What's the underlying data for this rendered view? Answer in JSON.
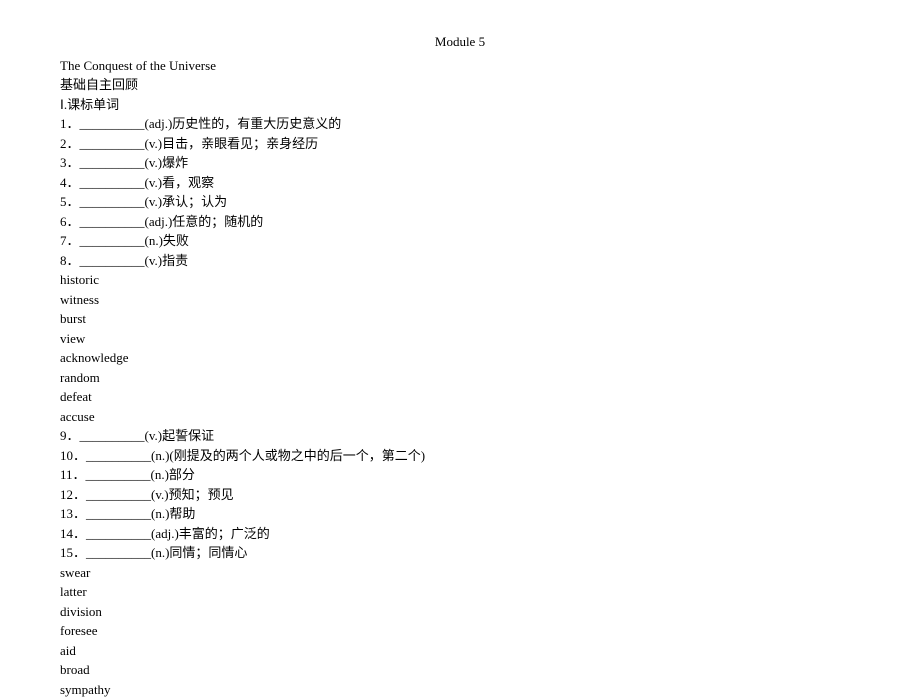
{
  "module_title": "Module 5",
  "title": "The Conquest of the Universe",
  "section": "基础自主回顾",
  "subsection": "Ⅰ.课标单词",
  "items1": [
    "1．__________(adj.)历史性的，有重大历史意义的",
    "2．__________(v.)目击，亲眼看见；亲身经历",
    "3．__________(v.)爆炸",
    "4．__________(v.)看，观察",
    "5．__________(v.)承认；认为",
    "6．__________(adj.)任意的；随机的",
    "7．__________(n.)失败",
    "8．__________(v.)指责"
  ],
  "answers1": [
    "historic",
    "witness",
    "burst",
    "view",
    "acknowledge",
    "random",
    "defeat",
    "accuse"
  ],
  "items2": [
    "9．__________(v.)起誓保证",
    "10．__________(n.)(刚提及的两个人或物之中的后一个，第二个)",
    "11．__________(n.)部分",
    "12．__________(v.)预知；预见",
    "13．__________(n.)帮助",
    "14．__________(adj.)丰富的；广泛的",
    "15．__________(n.)同情；同情心"
  ],
  "answers2": [
    "swear",
    "latter",
    "division",
    "foresee",
    "aid",
    "broad",
    "sympathy"
  ]
}
